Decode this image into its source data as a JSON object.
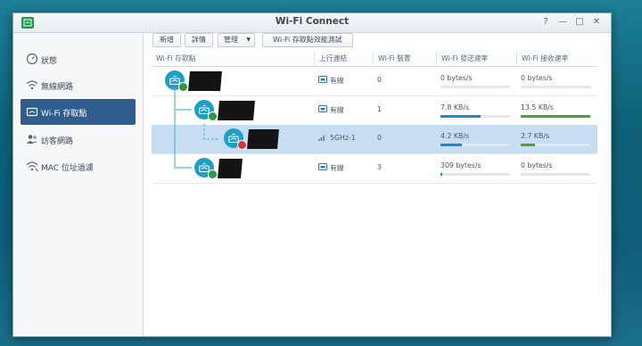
{
  "window": {
    "title": "Wi-Fi Connect"
  },
  "window_controls": {
    "help": "?",
    "minimize": "—",
    "maximize": "□",
    "close": "✕"
  },
  "sidebar": {
    "items": [
      {
        "label": "狀態",
        "icon": "gauge-icon",
        "active": false
      },
      {
        "label": "無線網路",
        "icon": "wifi-icon",
        "active": false
      },
      {
        "label": "Wi-Fi 存取點",
        "icon": "access-point-icon",
        "active": true
      },
      {
        "label": "訪客網路",
        "icon": "guests-icon",
        "active": false
      },
      {
        "label": "MAC 位址過濾",
        "icon": "wifi-filter-icon",
        "active": false
      }
    ]
  },
  "toolbar": {
    "add_label": "新增",
    "details_label": "詳情",
    "manage_label": "管理",
    "test_label": "Wi-Fi 存取點效能測試"
  },
  "table": {
    "columns": [
      "Wi-Fi 存取點",
      "上行連結",
      "Wi-Fi 裝置",
      "Wi-Fi 發送速率",
      "Wi-Fi 接收速率"
    ],
    "rows": [
      {
        "level": 0,
        "status": "ok",
        "uplink": "有線",
        "uplink_icon": "ethernet-icon",
        "devices": "0",
        "send": "0 bytes/s",
        "send_level": 0,
        "recv": "0 bytes/s",
        "recv_level": 0,
        "selected": false
      },
      {
        "level": 1,
        "status": "ok",
        "uplink": "有線",
        "uplink_icon": "ethernet-icon",
        "devices": "1",
        "send": "7.8 KB/s",
        "send_level": 0.58,
        "recv": "13.5 KB/s",
        "recv_level": 1.0,
        "selected": false
      },
      {
        "level": 2,
        "status": "error",
        "uplink": "5GHz-1",
        "uplink_icon": "signal-icon",
        "devices": "0",
        "send": "4.2 KB/s",
        "send_level": 0.31,
        "recv": "2.7 KB/s",
        "recv_level": 0.2,
        "selected": true
      },
      {
        "level": 1,
        "status": "ok",
        "uplink": "有線",
        "uplink_icon": "ethernet-icon",
        "devices": "3",
        "send": "309 bytes/s",
        "send_level": 0.02,
        "recv": "0 bytes/s",
        "recv_level": 0,
        "selected": false
      }
    ]
  },
  "colors": {
    "send_bar": "#1e88d0",
    "recv_bar": "#4aa52e",
    "node": "#1ea0c4",
    "ok_badge": "#2e9b46",
    "error_badge": "#d63434"
  }
}
